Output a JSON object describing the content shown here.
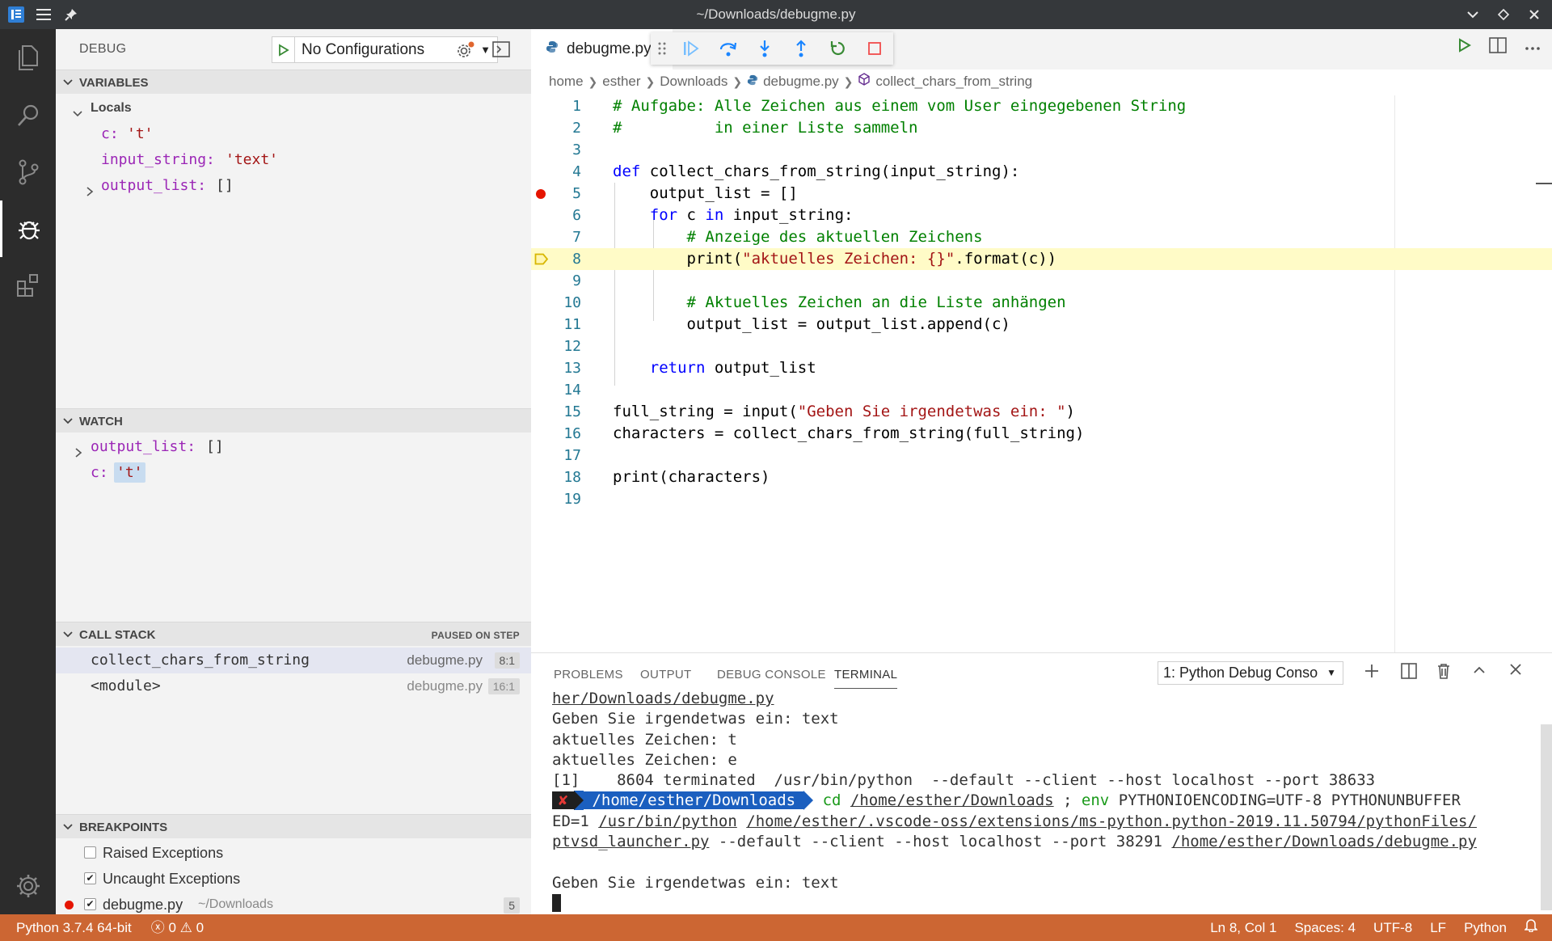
{
  "window": {
    "title": "~/Downloads/debugme.py"
  },
  "sidebar": {
    "title": "DEBUG",
    "config": "No Configurations",
    "variables": {
      "header": "VARIABLES",
      "scope": "Locals",
      "items": [
        {
          "name": "c:",
          "value": "'t'"
        },
        {
          "name": "input_string:",
          "value": "'text'"
        },
        {
          "name": "output_list:",
          "value": "[]"
        }
      ]
    },
    "watch": {
      "header": "WATCH",
      "items": [
        {
          "name": "output_list:",
          "value": "[]"
        },
        {
          "name": "c:",
          "value": "'t'"
        }
      ]
    },
    "callstack": {
      "header": "CALL STACK",
      "status": "PAUSED ON STEP",
      "frames": [
        {
          "name": "collect_chars_from_string",
          "file": "debugme.py",
          "pos": "8:1"
        },
        {
          "name": "<module>",
          "file": "debugme.py",
          "pos": "16:1"
        }
      ]
    },
    "breakpoints": {
      "header": "BREAKPOINTS",
      "items": [
        {
          "label": "Raised Exceptions",
          "checked": false
        },
        {
          "label": "Uncaught Exceptions",
          "checked": true
        },
        {
          "label": "debugme.py",
          "path": "~/Downloads",
          "count": "5",
          "checked": true
        }
      ]
    }
  },
  "editor": {
    "tab": "debugme.py",
    "breadcrumb": [
      "home",
      "esther",
      "Downloads",
      "debugme.py",
      "collect_chars_from_string"
    ],
    "lines": [
      {
        "n": "1",
        "text": "# Aufgabe: Alle Zeichen aus einem vom User eingegebenen String"
      },
      {
        "n": "2",
        "text": "#          in einer Liste sammeln"
      },
      {
        "n": "3",
        "text": ""
      },
      {
        "n": "4",
        "kw": "def",
        "text": " collect_chars_from_string(input_string):"
      },
      {
        "n": "5",
        "text": "    output_list = []"
      },
      {
        "n": "6",
        "pre": "    ",
        "kw": "for",
        "mid": " c ",
        "kw2": "in",
        "text": " input_string:"
      },
      {
        "n": "7",
        "text": "        # Anzeige des aktuellen Zeichens"
      },
      {
        "n": "8",
        "pre": "        print(",
        "str": "\"aktuelles Zeichen: {}\"",
        "text": ".format(c))"
      },
      {
        "n": "9",
        "text": ""
      },
      {
        "n": "10",
        "text": "        # Aktuelles Zeichen an die Liste anhängen"
      },
      {
        "n": "11",
        "text": "        output_list = output_list.append(c)"
      },
      {
        "n": "12",
        "text": ""
      },
      {
        "n": "13",
        "pre": "    ",
        "kw": "return",
        "text": " output_list"
      },
      {
        "n": "14",
        "text": ""
      },
      {
        "n": "15",
        "pre": "full_string = input(",
        "str": "\"Geben Sie irgendetwas ein: \"",
        "text": ")"
      },
      {
        "n": "16",
        "text": "characters = collect_chars_from_string(full_string)"
      },
      {
        "n": "17",
        "text": ""
      },
      {
        "n": "18",
        "text": "print(characters)"
      },
      {
        "n": "19",
        "text": ""
      }
    ]
  },
  "panel": {
    "tabs": [
      "PROBLEMS",
      "OUTPUT",
      "DEBUG CONSOLE",
      "TERMINAL"
    ],
    "terminal_select": "1: Python Debug Conso",
    "terminal": {
      "l1": "her/Downloads/debugme.py",
      "l2": "Geben Sie irgendetwas ein: text",
      "l3": "aktuelles Zeichen: t",
      "l4": "aktuelles Zeichen: e",
      "l5": "[1]    8604 terminated  /usr/bin/python  --default --client --host localhost --port 38633",
      "p_x": "✘",
      "p_dir": "/home/esther/Downloads",
      "p_cd": "cd",
      "p_cdpath": "/home/esther/Downloads",
      "p_semi": " ; ",
      "p_env": "env",
      "p_rest": " PYTHONIOENCODING=UTF-8 PYTHONUNBUFFER",
      "l7a": "ED=1 ",
      "l7b": "/usr/bin/python",
      "l7c": " ",
      "l7d": "/home/esther/.vscode-oss/extensions/ms-python.python-2019.11.50794/pythonFiles/",
      "l8a": "ptvsd_launcher.py",
      "l8b": " --default --client --host localhost --port 38291 ",
      "l8c": "/home/esther/Downloads/debugme.py",
      "l10": "Geben Sie irgendetwas ein: text"
    }
  },
  "statusbar": {
    "python": "Python 3.7.4 64-bit",
    "errors": "0",
    "warnings": "0",
    "position": "Ln 8, Col 1",
    "spaces": "Spaces: 4",
    "encoding": "UTF-8",
    "eol": "LF",
    "language": "Python"
  }
}
